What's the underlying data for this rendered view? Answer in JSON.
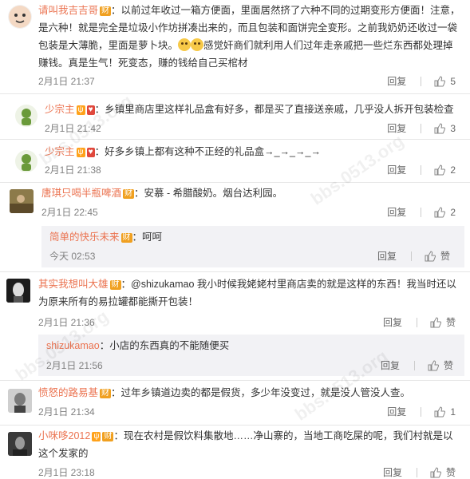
{
  "comments": [
    {
      "username": "请叫我吉吉哥",
      "badge": "财",
      "text": "：以前过年收过一箱方便面，里面居然挤了六种不同的过期变形方便面！注意，是六种！就是完全是垃圾小作坊拼凑出来的，而且包装和面饼完全变形。之前我奶奶还收过一袋包装是大薄脆，里面是萝卜块。",
      "text_after_emoji": "感觉奸商们就利用人们过年走亲戚把一些烂东西都处理掉赚钱。真是生气！死变态，赚的钱给自己买棺材",
      "time": "2月1日 21:37",
      "reply_label": "回复",
      "likes": "5"
    },
    {
      "username": "少宗主",
      "text": "：乡镇里商店里这样礼品盒有好多，都是买了直接送亲戚，几乎没人拆开包装检查",
      "time": "2月1日 21:42",
      "reply_label": "回复",
      "likes": "3"
    },
    {
      "username": "少宗主",
      "text": "：好多乡镇上都有这种不正经的礼品盒→_→_→_→",
      "time": "2月1日 21:38",
      "reply_label": "回复",
      "likes": "2"
    },
    {
      "username": "唐琪只喝半瓶啤酒",
      "badge": "财",
      "text": "：安慕 - 希腊酸奶。烟台达利园。",
      "time": "2月1日 22:45",
      "reply_label": "回复",
      "likes": "2",
      "sub_reply": {
        "username": "简单的快乐未来",
        "badge": "财",
        "text": "：呵呵",
        "time": "今天 02:53",
        "reply_label": "回复",
        "likes": "赞"
      }
    },
    {
      "username": "其实我想叫大雄",
      "badge": "财",
      "text": "：@shizukamao 我小时候我姥姥村里商店卖的就是这样的东西！我当时还以为原来所有的易拉罐都能撕开包装！",
      "time": "2月1日 21:36",
      "reply_label": "回复",
      "likes": "赞",
      "sub_reply": {
        "username": "shizukamao",
        "text": "：小店的东西真的不能随便买",
        "time": "2月1日 21:56",
        "reply_label": "回复",
        "likes": "赞"
      }
    },
    {
      "username": "愤怒的路易基",
      "badge": "财",
      "text": "：过年乡镇道边卖的都是假货，多少年没变过，就是没人管没人查。",
      "time": "2月1日 21:34",
      "reply_label": "回复",
      "likes": "1"
    },
    {
      "username": "小咪哆2012",
      "badge": "财",
      "text": "：现在农村是假饮料集散地……净山寨的，当地工商吃屎的呢，我们村就是以这个发家的",
      "time": "2月1日 23:18",
      "reply_label": "回复",
      "likes": "赞"
    }
  ],
  "watermark": "bbs.0513.org"
}
